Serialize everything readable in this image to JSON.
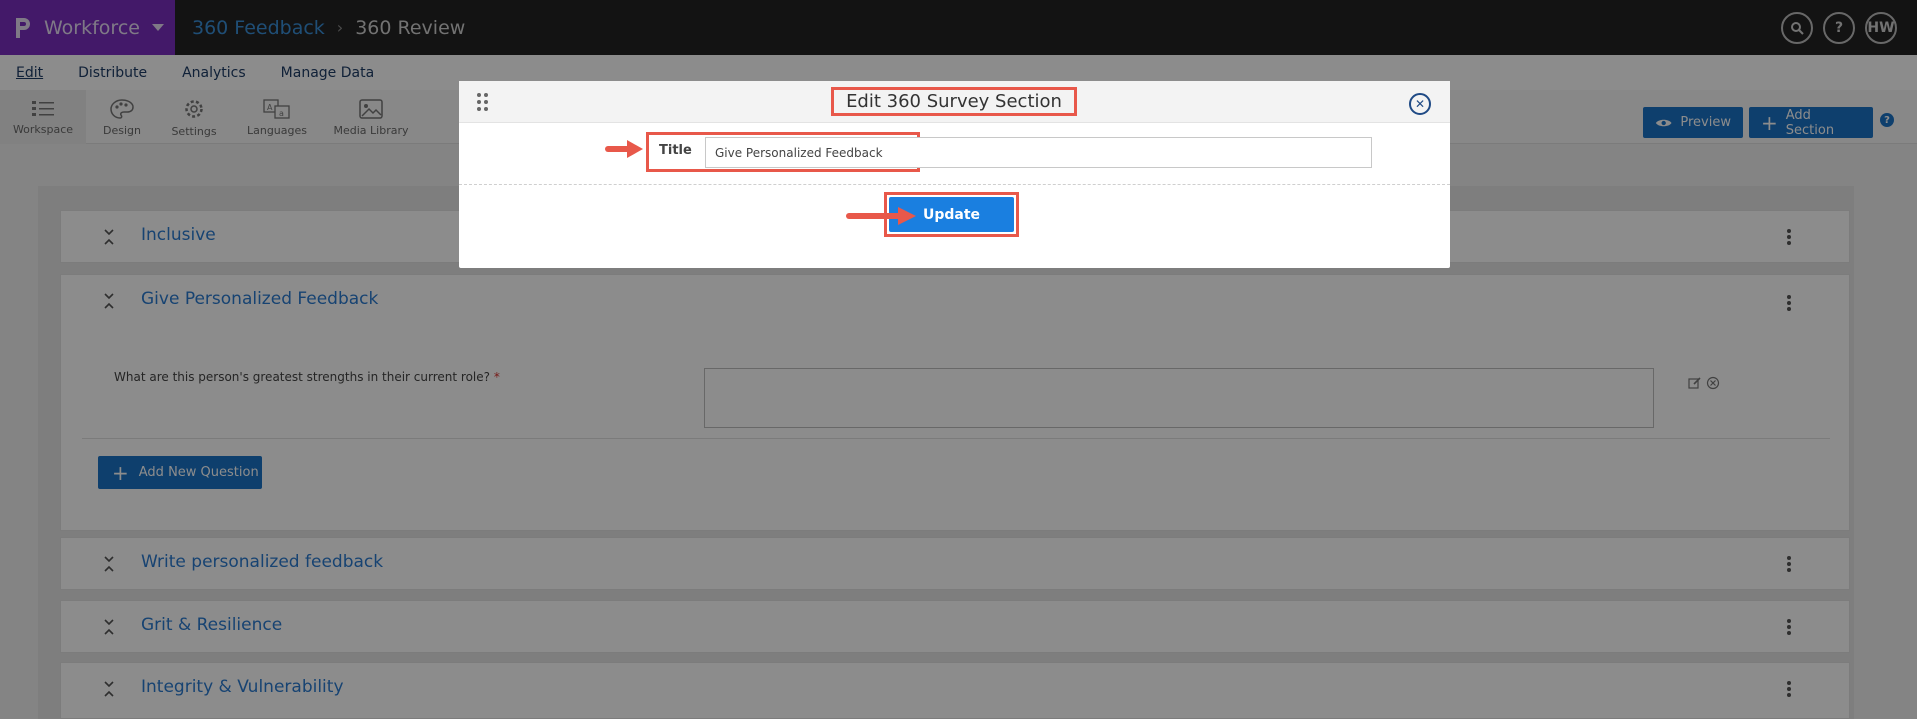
{
  "app": {
    "product": "Workforce",
    "breadcrumb_parent": "360 Feedback",
    "breadcrumb_current": "360 Review",
    "user_initials": "HW"
  },
  "menu": [
    "Edit",
    "Distribute",
    "Analytics",
    "Manage Data"
  ],
  "toolbar": {
    "tools": [
      "Workspace",
      "Design",
      "Settings",
      "Languages",
      "Media Library"
    ],
    "preview_label": "Preview",
    "add_section_label": "Add Section",
    "help": "?"
  },
  "sections": [
    {
      "title": "Inclusive"
    },
    {
      "title": "Give Personalized Feedback"
    },
    {
      "title": "Write personalized feedback"
    },
    {
      "title": "Grit & Resilience"
    },
    {
      "title": "Integrity & Vulnerability"
    }
  ],
  "question": {
    "text": "What are this person's greatest strengths in their current role?",
    "required_marker": "*"
  },
  "add_question_label": "Add New Question",
  "modal": {
    "title": "Edit 360 Survey Section",
    "field_label": "Title",
    "field_value": "Give Personalized Feedback",
    "update_label": "Update"
  },
  "colors": {
    "brand_purple": "#7a2fbf",
    "primary_blue": "#1a73c7",
    "highlight_red": "#e8584a"
  }
}
